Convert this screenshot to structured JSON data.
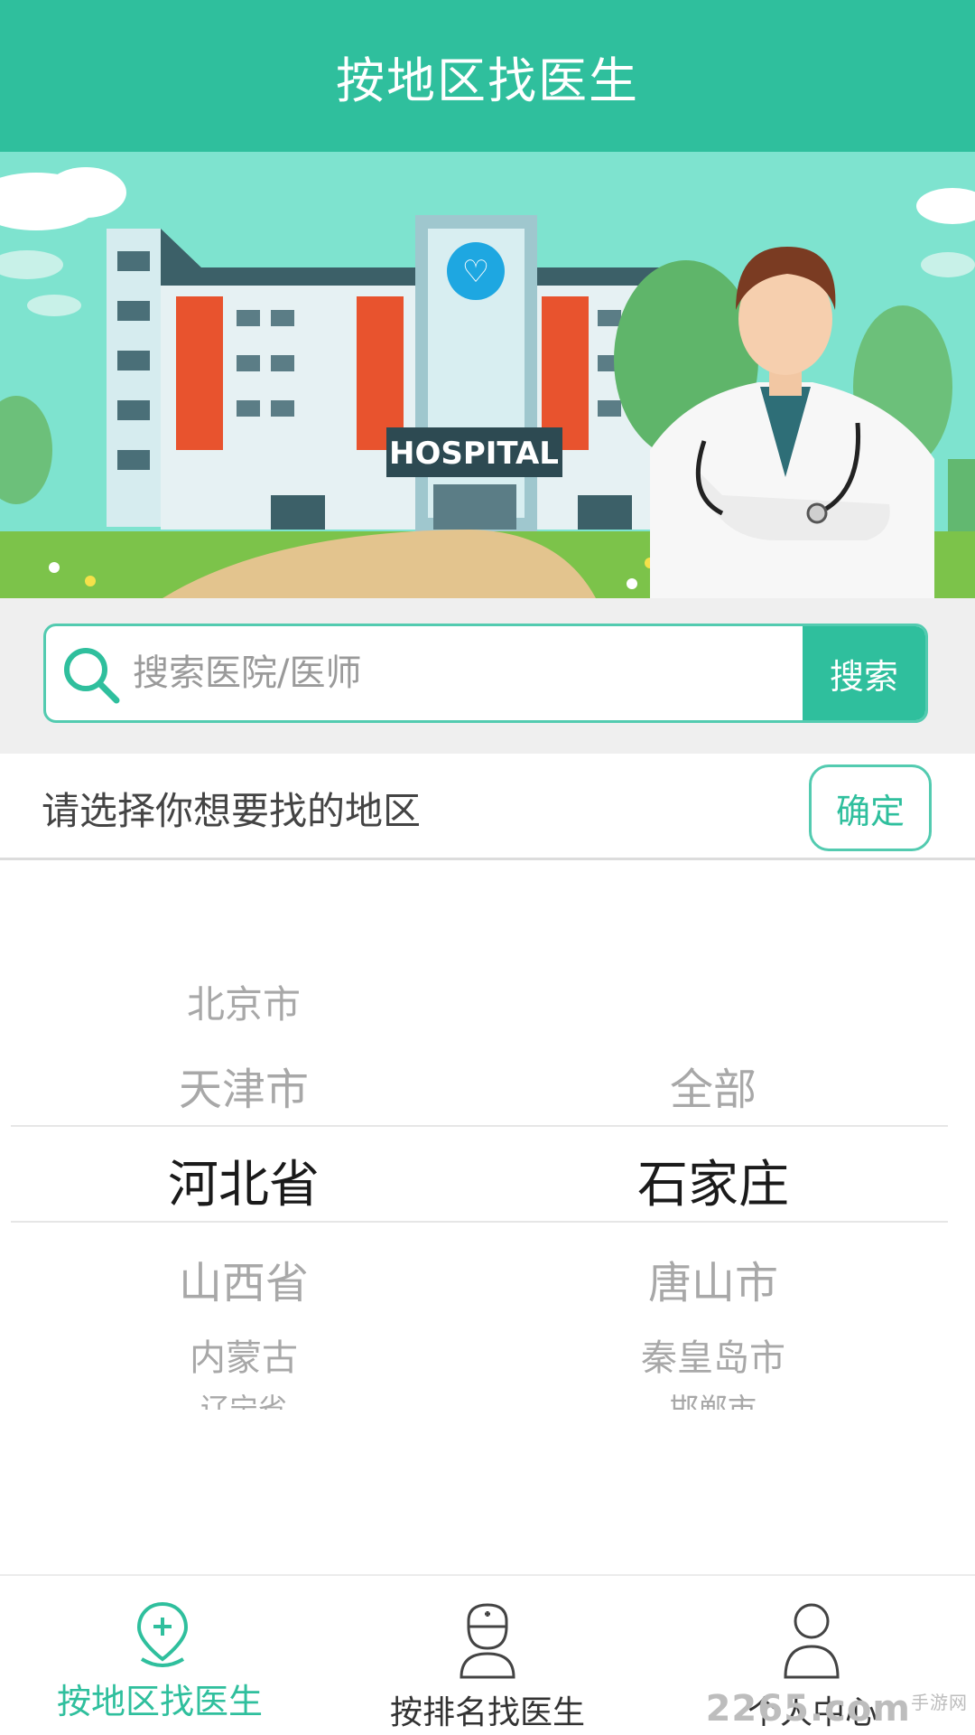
{
  "header": {
    "title": "按地区找医生"
  },
  "banner": {
    "sign_text": "HOSPITAL"
  },
  "search": {
    "placeholder": "搜索医院/医师",
    "button_label": "搜索"
  },
  "region_bar": {
    "prompt": "请选择你想要找的地区",
    "confirm_label": "确定"
  },
  "picker": {
    "provinces": [
      "北京市",
      "天津市",
      "河北省",
      "山西省",
      "内蒙古",
      "辽宁省"
    ],
    "cities": [
      "全部",
      "石家庄",
      "唐山市",
      "秦皇岛市",
      "邯郸市"
    ],
    "selected_province": "河北省",
    "selected_city": "石家庄"
  },
  "tabbar": {
    "tabs": [
      {
        "label": "按地区找医生",
        "icon": "location-plus-icon",
        "active": true
      },
      {
        "label": "按排名找医生",
        "icon": "doctor-icon",
        "active": false
      },
      {
        "label": "个人中心",
        "icon": "person-icon",
        "active": false
      }
    ]
  },
  "watermark": {
    "text": "2265",
    "suffix": ".com",
    "site": "手游网"
  },
  "colors": {
    "accent": "#2fbf9d",
    "accent_light": "#53cbb0",
    "muted_text": "#a8a8a8"
  }
}
